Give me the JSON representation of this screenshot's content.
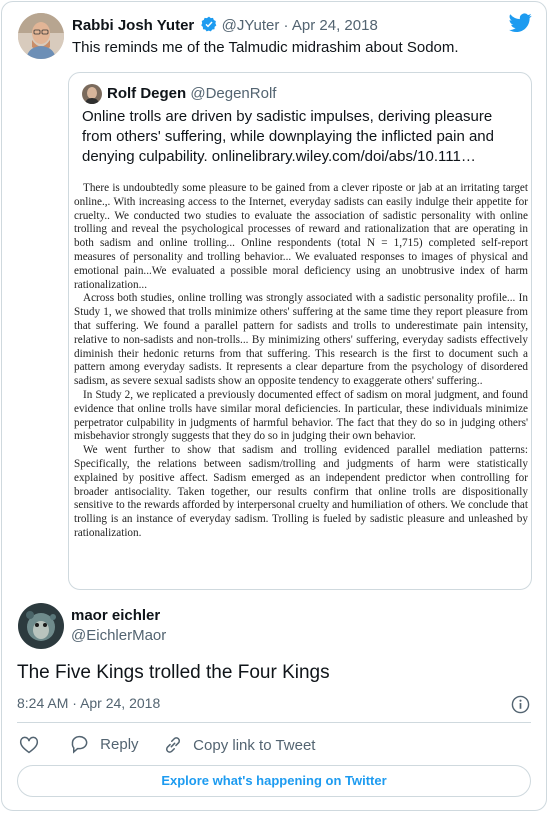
{
  "tweet": {
    "author_name": "Rabbi Josh Yuter",
    "author_handle": "@JYuter",
    "separator": "·",
    "date": "Apr 24, 2018",
    "text": "This reminds me of the Talmudic midrashim about Sodom.",
    "verified_icon": "verified-badge-icon",
    "brand_icon": "twitter-bird-icon",
    "brand_color": "#1d9bf0"
  },
  "quoted": {
    "author_name": "Rolf Degen",
    "author_handle": "@DegenRolf",
    "text": "Online trolls are driven by sadistic impulses, deriving pleasure from others' suffering, while downplaying the inflicted pain and denying culpability. onlinelibrary.wiley.com/doi/abs/10.111…",
    "image_paragraphs": [
      "There is undoubtedly some pleasure to be gained from a clever riposte or jab at an irritating target online.,. With increasing access to the Internet, everyday sadists can easily indulge their appetite for cruelty.. We conducted two studies to evaluate the association of sadistic personality with online trolling and reveal the psychological processes of reward and rationalization that are operating in both sadism and online trolling... Online respondents (total N = 1,715) completed self-report measures of personality and trolling behavior... We evaluated responses to images of physical and emotional pain...We evaluated a possible moral deficiency using an unobtrusive index of harm rationalization...",
      "Across both studies, online trolling was strongly associated with a sadistic personality profile... In Study 1, we showed that trolls minimize others' suffering at the same time they report pleasure from that suffering. We found a parallel pattern for sadists and trolls to underestimate pain intensity, relative to non-sadists and non-trolls... By minimizing others' suffering, everyday sadists effectively diminish their hedonic returns from that suffering. This research is the first to document such a pattern among everyday sadists. It represents a clear departure from the psychology of disordered sadism, as severe sexual sadists show an opposite tendency to exaggerate others' suffering..",
      "In Study 2, we replicated a previously documented effect of sadism on moral judgment, and found evidence that online trolls have similar moral deficiencies. In particular, these individuals minimize perpetrator culpability in judgments of harmful behavior. The fact that they do so in judging others' misbehavior strongly suggests that they do so in judging their own behavior.",
      "We went further to show that sadism and trolling evidenced parallel mediation patterns: Specifically, the relations between sadism/trolling and judgments of harm were statistically explained by positive affect. Sadism emerged as an independent predictor when controlling for broader antisociality. Taken together, our results confirm that online trolls are dispositionally sensitive to the rewards afforded by interpersonal cruelty and humiliation of others. We conclude that trolling is an instance of everyday sadism. Trolling is fueled by sadistic pleasure and unleashed by rationalization."
    ]
  },
  "reply": {
    "author_name": "maor eichler",
    "author_handle": "@EichlerMaor",
    "text": "The Five Kings trolled the Four Kings",
    "time": "8:24 AM",
    "separator": "·",
    "date": "Apr 24, 2018",
    "info_icon": "info-icon"
  },
  "actions": {
    "like_icon": "heart-icon",
    "reply_icon": "speech-bubble-icon",
    "reply_label": "Reply",
    "link_icon": "link-icon",
    "copy_label": "Copy link to Tweet"
  },
  "footer": {
    "explore_label": "Explore what's happening on Twitter"
  }
}
